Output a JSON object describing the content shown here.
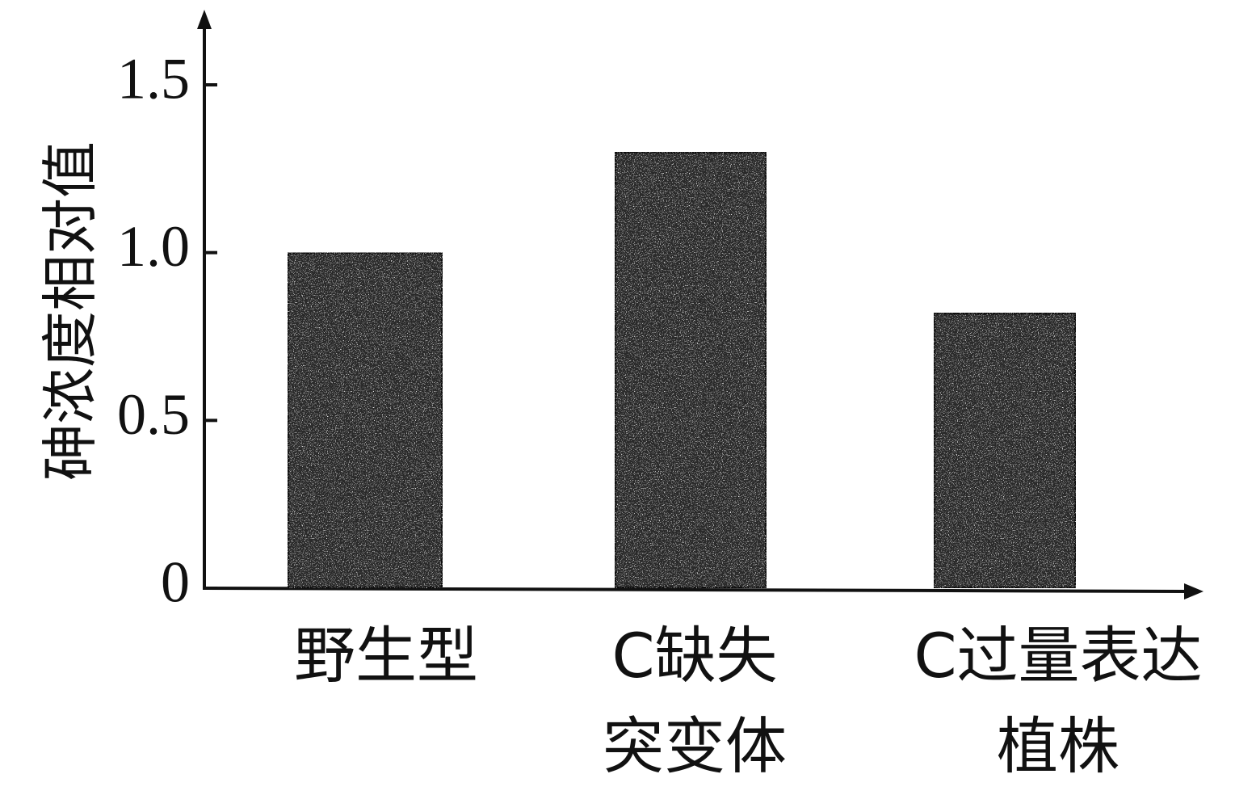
{
  "chart_data": {
    "type": "bar",
    "categories": [
      [
        "野生型"
      ],
      [
        "C缺失",
        "突变体"
      ],
      [
        "C过量表达",
        "植株"
      ]
    ],
    "values": [
      1.0,
      1.3,
      0.82
    ],
    "ylabel": "砷浓度相对值",
    "xlabel": "",
    "title": "",
    "ylim": [
      0,
      1.5
    ],
    "yticks": [
      0,
      0.5,
      1.0,
      1.5
    ],
    "ytick_labels": [
      "0",
      "0.5",
      "1.0",
      "1.5"
    ],
    "grid": false,
    "legend": "none",
    "bar_fill": "#2a2a2a",
    "bar_pattern": "speckled",
    "axis_color": "#111111"
  }
}
